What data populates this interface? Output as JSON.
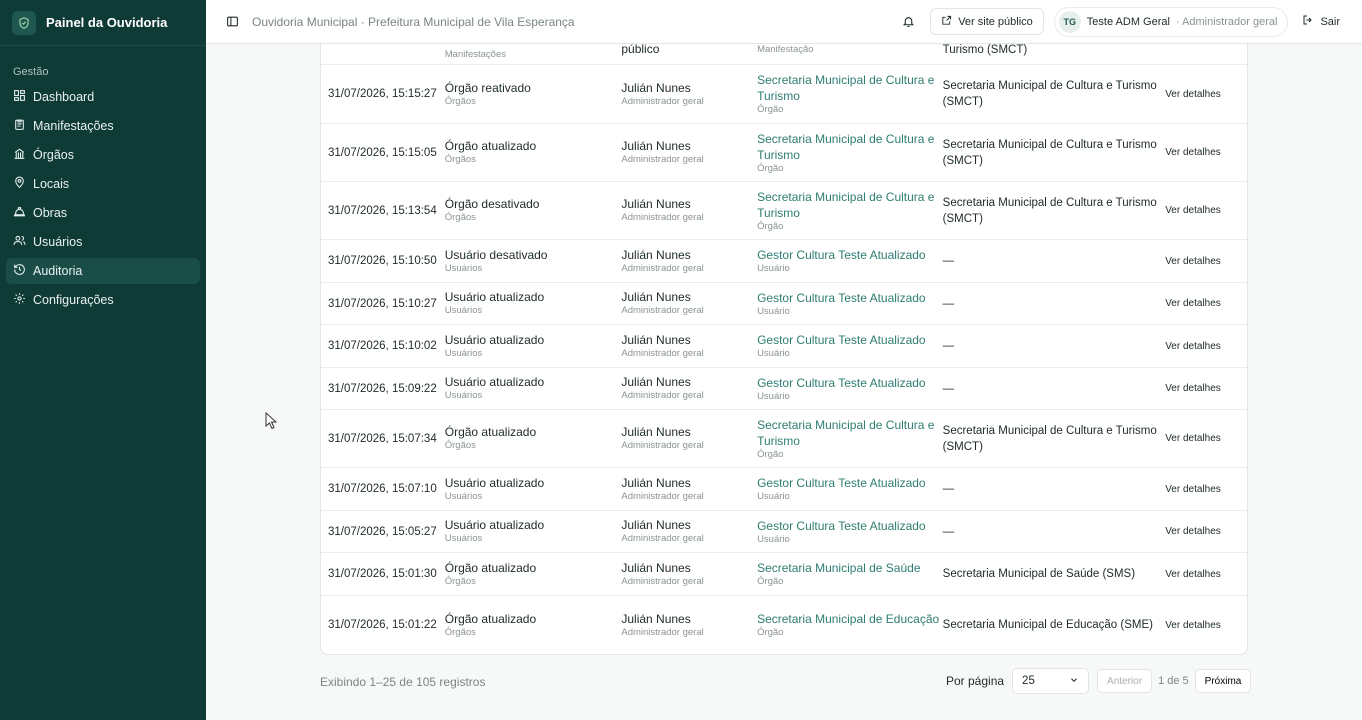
{
  "sidebar": {
    "title": "Painel da Ouvidoria",
    "section_label": "Gestão",
    "items": [
      {
        "label": "Dashboard",
        "icon": "dashboard-icon"
      },
      {
        "label": "Manifestações",
        "icon": "clipboard-icon"
      },
      {
        "label": "Órgãos",
        "icon": "building-icon"
      },
      {
        "label": "Locais",
        "icon": "map-pin-icon"
      },
      {
        "label": "Obras",
        "icon": "hard-hat-icon"
      },
      {
        "label": "Usuários",
        "icon": "users-icon"
      },
      {
        "label": "Auditoria",
        "icon": "history-icon",
        "active": true
      },
      {
        "label": "Configurações",
        "icon": "gear-icon"
      }
    ]
  },
  "topbar": {
    "breadcrumb": "Ouvidoria Municipal · Prefeitura Municipal de Vila Esperança",
    "public_site_label": "Ver site público",
    "user_initials": "TG",
    "user_name": "Teste ADM Geral",
    "user_role": "· Administrador geral",
    "logout_label": "Sair"
  },
  "table": {
    "partial_row": {
      "action_type": "Manifestações",
      "user_main": "público",
      "target_type": "Manifestação",
      "org": "Turismo (SMCT)"
    },
    "rows": [
      {
        "date": "31/07/2026, 15:15:27",
        "action": "Órgão reativado",
        "action_type": "Órgãos",
        "user": "Julián Nunes",
        "role": "Administrador geral",
        "target": "Secretaria Municipal de Cultura e Turismo",
        "target_type": "Órgão",
        "org": "Secretaria Municipal de Cultura e Turismo (SMCT)",
        "link": "Ver detalhes"
      },
      {
        "date": "31/07/2026, 15:15:05",
        "action": "Órgão atualizado",
        "action_type": "Órgãos",
        "user": "Julián Nunes",
        "role": "Administrador geral",
        "target": "Secretaria Municipal de Cultura e Turismo",
        "target_type": "Órgão",
        "org": "Secretaria Municipal de Cultura e Turismo (SMCT)",
        "link": "Ver detalhes"
      },
      {
        "date": "31/07/2026, 15:13:54",
        "action": "Órgão desativado",
        "action_type": "Órgãos",
        "user": "Julián Nunes",
        "role": "Administrador geral",
        "target": "Secretaria Municipal de Cultura e Turismo",
        "target_type": "Órgão",
        "org": "Secretaria Municipal de Cultura e Turismo (SMCT)",
        "link": "Ver detalhes"
      },
      {
        "date": "31/07/2026, 15:10:50",
        "action": "Usuário desativado",
        "action_type": "Usuários",
        "user": "Julián Nunes",
        "role": "Administrador geral",
        "target": "Gestor Cultura Teste Atualizado",
        "target_type": "Usuário",
        "org": "—",
        "link": "Ver detalhes"
      },
      {
        "date": "31/07/2026, 15:10:27",
        "action": "Usuário atualizado",
        "action_type": "Usuários",
        "user": "Julián Nunes",
        "role": "Administrador geral",
        "target": "Gestor Cultura Teste Atualizado",
        "target_type": "Usuário",
        "org": "—",
        "link": "Ver detalhes"
      },
      {
        "date": "31/07/2026, 15:10:02",
        "action": "Usuário atualizado",
        "action_type": "Usuários",
        "user": "Julián Nunes",
        "role": "Administrador geral",
        "target": "Gestor Cultura Teste Atualizado",
        "target_type": "Usuário",
        "org": "—",
        "link": "Ver detalhes"
      },
      {
        "date": "31/07/2026, 15:09:22",
        "action": "Usuário atualizado",
        "action_type": "Usuários",
        "user": "Julián Nunes",
        "role": "Administrador geral",
        "target": "Gestor Cultura Teste Atualizado",
        "target_type": "Usuário",
        "org": "—",
        "link": "Ver detalhes"
      },
      {
        "date": "31/07/2026, 15:07:34",
        "action": "Órgão atualizado",
        "action_type": "Órgãos",
        "user": "Julián Nunes",
        "role": "Administrador geral",
        "target": "Secretaria Municipal de Cultura e Turismo",
        "target_type": "Órgão",
        "org": "Secretaria Municipal de Cultura e Turismo (SMCT)",
        "link": "Ver detalhes"
      },
      {
        "date": "31/07/2026, 15:07:10",
        "action": "Usuário atualizado",
        "action_type": "Usuários",
        "user": "Julián Nunes",
        "role": "Administrador geral",
        "target": "Gestor Cultura Teste Atualizado",
        "target_type": "Usuário",
        "org": "—",
        "link": "Ver detalhes"
      },
      {
        "date": "31/07/2026, 15:05:27",
        "action": "Usuário atualizado",
        "action_type": "Usuários",
        "user": "Julián Nunes",
        "role": "Administrador geral",
        "target": "Gestor Cultura Teste Atualizado",
        "target_type": "Usuário",
        "org": "—",
        "link": "Ver detalhes"
      },
      {
        "date": "31/07/2026, 15:01:30",
        "action": "Órgão atualizado",
        "action_type": "Órgãos",
        "user": "Julián Nunes",
        "role": "Administrador geral",
        "target": "Secretaria Municipal de Saúde",
        "target_type": "Órgão",
        "org": "Secretaria Municipal de Saúde (SMS)",
        "link": "Ver detalhes"
      },
      {
        "date": "31/07/2026, 15:01:22",
        "action": "Órgão atualizado",
        "action_type": "Órgãos",
        "user": "Julián Nunes",
        "role": "Administrador geral",
        "target": "Secretaria Municipal de Educação",
        "target_type": "Órgão",
        "org": "Secretaria Municipal de Educação (SME)",
        "link": "Ver detalhes"
      }
    ]
  },
  "footer": {
    "showing": "Exibindo 1–25 de 105 registros",
    "per_page_label": "Por página",
    "per_page_value": "25",
    "prev_label": "Anterior",
    "page_info": "1 de 5",
    "next_label": "Próxima"
  },
  "colors": {
    "sidebar_bg": "#0f3b37",
    "sidebar_active": "#1a4d48",
    "link_green": "#2e7d70"
  }
}
